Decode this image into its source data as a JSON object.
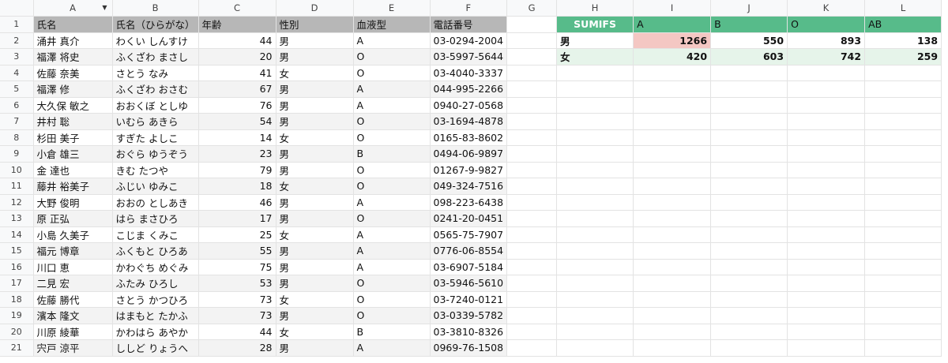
{
  "columns": [
    "",
    "A",
    "B",
    "C",
    "D",
    "E",
    "F",
    "G",
    "H",
    "I",
    "J",
    "K",
    "L"
  ],
  "headers": [
    "氏名",
    "氏名（ひらがな）",
    "年齢",
    "性別",
    "血液型",
    "電話番号"
  ],
  "rows": [
    [
      "涌井 真介",
      "わくい しんすけ",
      "44",
      "男",
      "A",
      "03-0294-2004"
    ],
    [
      "福澤 将史",
      "ふくざわ まさし",
      "20",
      "男",
      "O",
      "03-5997-5644"
    ],
    [
      "佐藤 奈美",
      "さとう なみ",
      "41",
      "女",
      "O",
      "03-4040-3337"
    ],
    [
      "福澤 修",
      "ふくざわ おさむ",
      "67",
      "男",
      "A",
      "044-995-2266"
    ],
    [
      "大久保 敏之",
      "おおくぼ としゆ",
      "76",
      "男",
      "A",
      "0940-27-0568"
    ],
    [
      "井村 聡",
      "いむら あきら",
      "54",
      "男",
      "O",
      "03-1694-4878"
    ],
    [
      "杉田 美子",
      "すぎた よしこ",
      "14",
      "女",
      "O",
      "0165-83-8602"
    ],
    [
      "小倉 雄三",
      "おぐら ゆうぞう",
      "23",
      "男",
      "B",
      "0494-06-9897"
    ],
    [
      "金 達也",
      "きむ たつや",
      "79",
      "男",
      "O",
      "01267-9-9827"
    ],
    [
      "藤井 裕美子",
      "ふじい ゆみこ",
      "18",
      "女",
      "O",
      "049-324-7516"
    ],
    [
      "大野 俊明",
      "おおの としあき",
      "46",
      "男",
      "A",
      "098-223-6438"
    ],
    [
      "原 正弘",
      "はら まさひろ",
      "17",
      "男",
      "O",
      "0241-20-0451"
    ],
    [
      "小島 久美子",
      "こじま くみこ",
      "25",
      "女",
      "A",
      "0565-75-7907"
    ],
    [
      "福元 博章",
      "ふくもと ひろあ",
      "55",
      "男",
      "A",
      "0776-06-8554"
    ],
    [
      "川口 恵",
      "かわぐち めぐみ",
      "75",
      "男",
      "A",
      "03-6907-5184"
    ],
    [
      "二見 宏",
      "ふたみ ひろし",
      "53",
      "男",
      "O",
      "03-5946-5610"
    ],
    [
      "佐藤 勝代",
      "さとう かつひろ",
      "73",
      "女",
      "O",
      "03-7240-0121"
    ],
    [
      "濱本 隆文",
      "はまもと たかふ",
      "73",
      "男",
      "O",
      "03-0339-5782"
    ],
    [
      "川原 綾華",
      "かわはら あやか",
      "44",
      "女",
      "B",
      "03-3810-8326"
    ],
    [
      "宍戸 涼平",
      "ししど りょうへ",
      "28",
      "男",
      "A",
      "0969-76-1508"
    ]
  ],
  "sumifs": {
    "label": "SUMIFS",
    "blood_types": [
      "A",
      "B",
      "O",
      "AB"
    ],
    "rows": [
      {
        "gender": "男",
        "values": [
          "1266",
          "550",
          "893",
          "138"
        ]
      },
      {
        "gender": "女",
        "values": [
          "420",
          "603",
          "742",
          "259"
        ]
      }
    ]
  },
  "colors": {
    "header_gray": "#b7b7b7",
    "sumifs_green": "#57bb8a",
    "light_green": "#e6f4ea",
    "highlight_pink": "#f4c7c3",
    "zebra": "#f3f3f3"
  },
  "icons": {
    "column_a_dropdown": "triangle-down"
  }
}
